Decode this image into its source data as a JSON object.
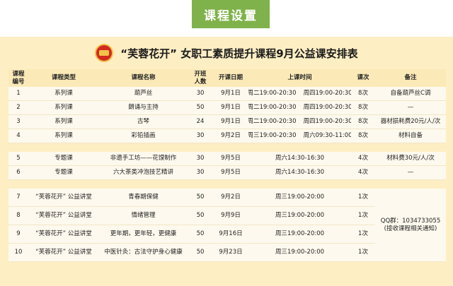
{
  "tab_label": "课程设置",
  "title": "“芙蓉花开” 女职工素质提升课程9月公益课安排表",
  "logo_text": "芙蓉花开",
  "columns": [
    "课程编号",
    "课程类型",
    "课程名称",
    "开班人数",
    "开课日期",
    "上课时间",
    "课次",
    "备注"
  ],
  "header_lines": {
    "c0": [
      "课程",
      "编号"
    ],
    "c3": [
      "开班",
      "人数"
    ]
  },
  "groups": [
    [
      {
        "no": "1",
        "type": "系列课",
        "name": "葫芦丝",
        "count": "30",
        "date": "9月1日",
        "time": [
          "周二19:00-20:30",
          "周四19:00-20:30"
        ],
        "times": "8次",
        "note": "自备葫芦丝C调"
      },
      {
        "no": "2",
        "type": "系列课",
        "name": "朗诵与主持",
        "count": "50",
        "date": "9月1日",
        "time": [
          "周二19:00-20:30",
          "周四19:00-20:30"
        ],
        "times": "8次",
        "note": "—"
      },
      {
        "no": "3",
        "type": "系列课",
        "name": "古琴",
        "count": "24",
        "date": "9月1日",
        "time": [
          "周二19:00-20:30",
          "周四19:00-20:30"
        ],
        "times": "8次",
        "note": "器材损耗费20元/人/次"
      },
      {
        "no": "4",
        "type": "系列课",
        "name": "彩铅插画",
        "count": "30",
        "date": "9月2日",
        "time": [
          "周三19:00-20:30",
          "周六09:30-11:00"
        ],
        "times": "8次",
        "note": "材料自备"
      }
    ],
    [
      {
        "no": "5",
        "type": "专题课",
        "name": "非遗手工坊——花馍制作",
        "count": "30",
        "date": "9月5日",
        "time": [
          "周六14:30-16:30"
        ],
        "times": "4次",
        "note": "材料费30元/人/次"
      },
      {
        "no": "6",
        "type": "专题课",
        "name": "六大茶类冲泡技艺精讲",
        "count": "30",
        "date": "9月5日",
        "time": [
          "周六14:30-16:30"
        ],
        "times": "4次",
        "note": "—"
      }
    ],
    [
      {
        "no": "7",
        "type": "“芙蓉花开” 公益讲堂",
        "name": "青春期保健",
        "count": "50",
        "date": "9月2日",
        "time": [
          "周三19:00-20:00"
        ],
        "times": "1次"
      },
      {
        "no": "8",
        "type": "“芙蓉花开” 公益讲堂",
        "name": "情绪管理",
        "count": "50",
        "date": "9月9日",
        "time": [
          "周三19:00-20:00"
        ],
        "times": "1次"
      },
      {
        "no": "9",
        "type": "“芙蓉花开” 公益讲堂",
        "name": "更年期，更年轻，更健康",
        "count": "50",
        "date": "9月16日",
        "time": [
          "周三19:00-20:00"
        ],
        "times": "1次"
      },
      {
        "no": "10",
        "type": "“芙蓉花开” 公益讲堂",
        "name": "中医针灸：古法守护身心健康",
        "count": "50",
        "date": "9月23日",
        "time": [
          "周三19:00-20:00"
        ],
        "times": "1次"
      }
    ]
  ],
  "group3_note": {
    "qq": "QQ群：1034733055",
    "sub": "(接收课程相关通知)"
  }
}
